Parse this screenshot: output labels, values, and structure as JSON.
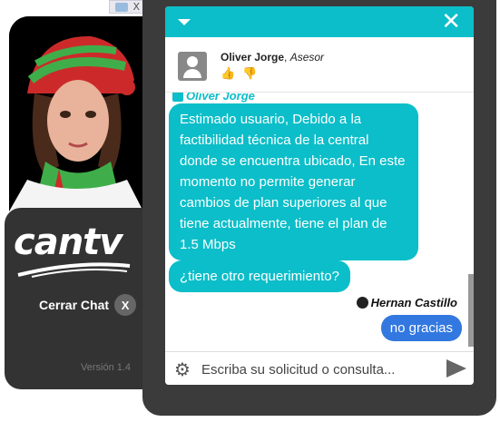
{
  "ad": {
    "close_label": "X"
  },
  "brand": {
    "logo_text": "cantv",
    "close_chat_label": "Cerrar Chat",
    "close_chat_button": "X",
    "version": "Versión 1.4"
  },
  "chat": {
    "close_icon": "✕",
    "agent": {
      "name": "Oliver Jorge",
      "role": "Asesor",
      "sender_label": "Oliver Jorge"
    },
    "messages": [
      {
        "from": "agent",
        "text": "Estimado usuario, Debido a la factibilidad técnica de la central donde se encuentra ubicado, En este momento no permite generar cambios de plan superiores al que tiene actualmente, tiene el plan de 1.5 Mbps"
      },
      {
        "from": "agent",
        "text": "¿tiene otro requerimiento?"
      },
      {
        "from": "user",
        "text": "no gracias"
      }
    ],
    "user_name": "Hernan Castillo",
    "input_placeholder": "Escriba su solicitud o consulta..."
  },
  "colors": {
    "accent": "#0bbec9",
    "user_bubble": "#3278e0",
    "frame": "#3b3b3b"
  }
}
